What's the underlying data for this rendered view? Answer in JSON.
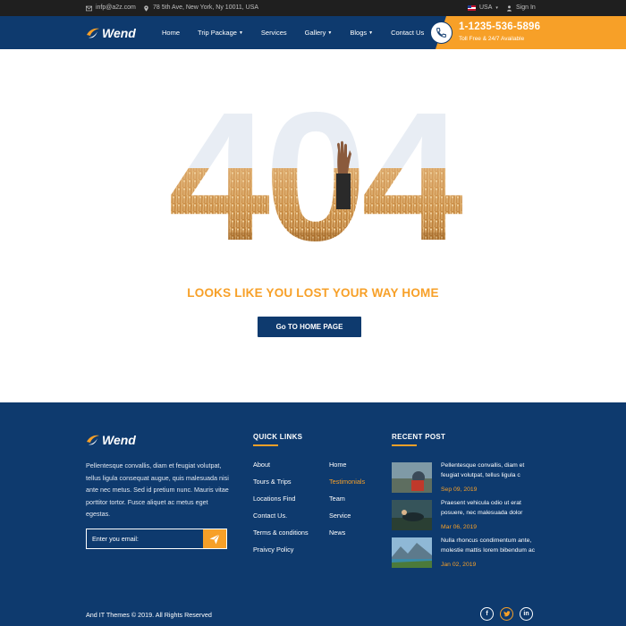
{
  "topbar": {
    "email": "infp@a2z.com",
    "address": "78 5th Ave, New York, Ny 10011, USA",
    "language": "USA",
    "signin": "Sign In"
  },
  "brand": {
    "name": "Wend"
  },
  "nav": {
    "items": [
      {
        "label": "Home",
        "dropdown": false
      },
      {
        "label": "Trip Package",
        "dropdown": true
      },
      {
        "label": "Services",
        "dropdown": false
      },
      {
        "label": "Gallery",
        "dropdown": true
      },
      {
        "label": "Blogs",
        "dropdown": true
      },
      {
        "label": "Contact Us",
        "dropdown": false
      }
    ]
  },
  "call": {
    "number": "1-1235-536-5896",
    "note": "Toll Free & 24/7 Available"
  },
  "error": {
    "code": "404",
    "headline": "LOOKS LIKE YOU LOST YOUR WAY HOME",
    "button": "Go TO HOME PAGE"
  },
  "footer": {
    "about": "Pellentesque convallis, diam et feugiat volutpat, tellus ligula consequat augue, quis malesuada nisi ante nec metus. Sed id pretium nunc. Mauris vitae porttitor tortor. Fusce aliquet ac metus eget egestas.",
    "newsletter_placeholder": "Enter you email:",
    "quick_links_title": "QUICK LINKS",
    "links_col1": [
      "About",
      "Tours & Trips",
      "Locations Find",
      "Contact Us.",
      "Terms & conditions",
      "Praivcy Policy"
    ],
    "links_col2": [
      "Home",
      "Testimonials",
      "Team",
      "Service",
      "News"
    ],
    "recent_title": "RECENT POST",
    "posts": [
      {
        "text": "Pellentesque convallis, diam et feugiat volutpat, tellus ligula c",
        "date": "Sep 09, 2019"
      },
      {
        "text": "Praesent vehicula odio ut erat posuere, nec malesuada dolor",
        "date": "Mar 06, 2019"
      },
      {
        "text": "Nulla rhoncus condimentum ante, molestie mattis lorem bibendum ac",
        "date": "Jan 02, 2019"
      }
    ],
    "copyright": "And IT Themes © 2019. All Rights Reserved"
  },
  "colors": {
    "navy": "#0e3a6e",
    "orange": "#f7a028",
    "topbar": "#1f1f1f"
  },
  "icons": [
    "mail-icon",
    "location-pin-icon",
    "us-flag-icon",
    "user-icon",
    "phone-icon",
    "paper-plane-icon",
    "facebook-icon",
    "twitter-icon",
    "linkedin-icon"
  ]
}
